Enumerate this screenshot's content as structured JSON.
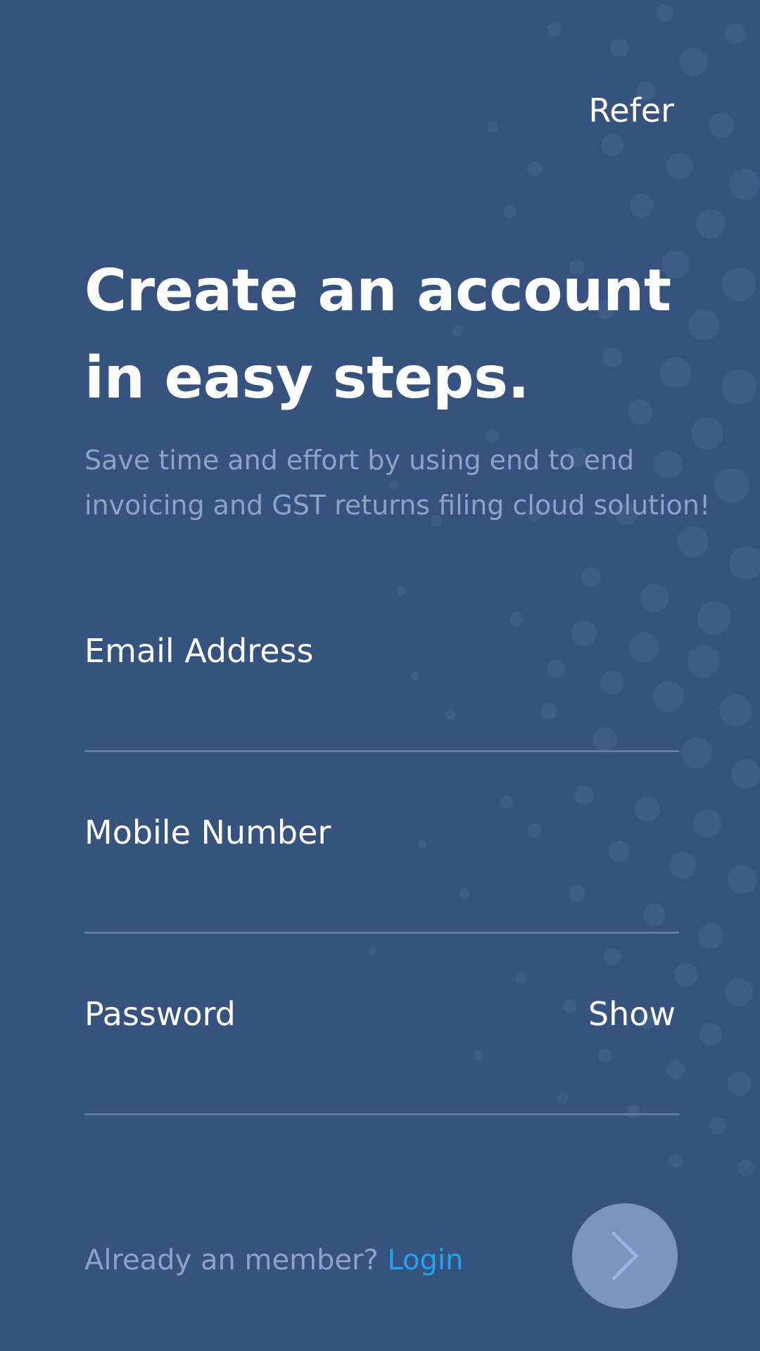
{
  "header": {
    "refer_label": "Refer"
  },
  "hero": {
    "title_line1": "Create an account",
    "title_line2": "in easy steps.",
    "subtitle_line1": "Save time and effort by using end to end",
    "subtitle_line2": "invoicing and GST returns filing cloud solution!"
  },
  "form": {
    "email": {
      "label": "Email Address",
      "value": "",
      "placeholder": ""
    },
    "mobile": {
      "label": "Mobile Number",
      "value": "",
      "placeholder": ""
    },
    "password": {
      "label": "Password",
      "value": "",
      "placeholder": "",
      "show_label": "Show"
    }
  },
  "footer": {
    "already_member_text": "Already an member?",
    "login_label": "Login",
    "next_icon": "chevron-right-icon"
  },
  "colors": {
    "background": "#36527f",
    "subtitle": "#8ea2c6",
    "divider": "#5f7aa4",
    "link": "#1ea5ee",
    "next_button": "#7a93c1"
  }
}
